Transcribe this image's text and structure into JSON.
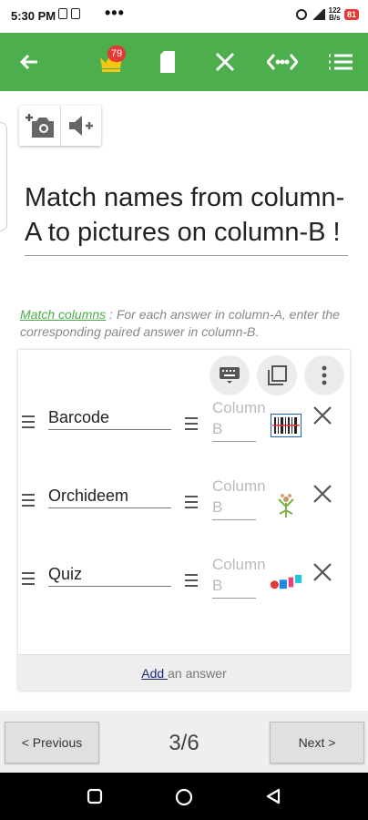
{
  "status_bar": {
    "time": "5:30 PM",
    "more": "•••",
    "net_speed": "122\nB/s",
    "battery": "81"
  },
  "toolbar": {
    "back_icon": "arrow-left-icon",
    "crown_badge": "79",
    "icons": [
      "crown-icon",
      "sd-card-icon",
      "close-icon",
      "code-icon",
      "list-icon"
    ],
    "color": "#4cae4c"
  },
  "question": {
    "text": "Match names from column-A to pictures on column-B !"
  },
  "hint": {
    "link": "Match columns",
    "rest": " : For each answer in column-A, enter the corresponding paired answer in column-B."
  },
  "panel": {
    "actions": [
      "keyboard-icon",
      "copy-icon",
      "more-vertical-icon"
    ],
    "rows": [
      {
        "a": "Barcode",
        "b_placeholder": "Column B",
        "thumb": "barcode-image"
      },
      {
        "a": "Orchideem",
        "b_placeholder": "Column B",
        "thumb": "orchid-image"
      },
      {
        "a": "Quiz",
        "b_placeholder": "Column B",
        "thumb": "quiz-image"
      }
    ],
    "add_link": "Add ",
    "add_rest": "an answer"
  },
  "nav": {
    "previous": "< Previous",
    "pager": "3/6",
    "next": "Next >"
  }
}
